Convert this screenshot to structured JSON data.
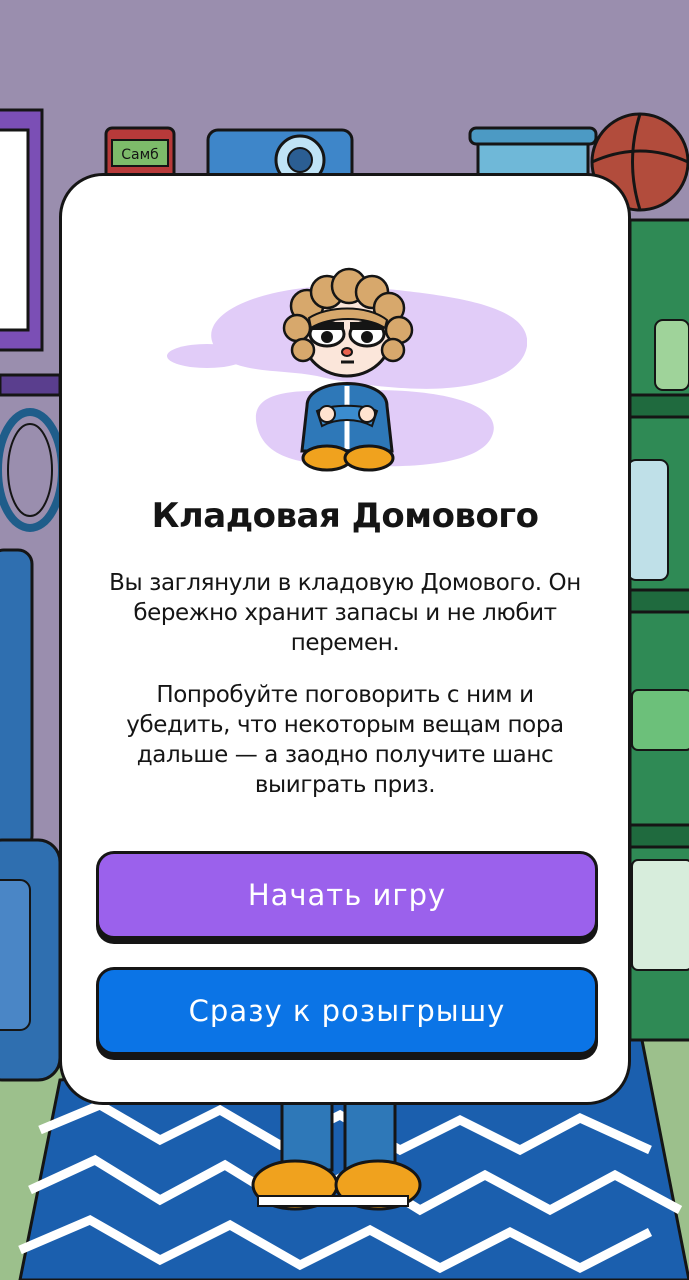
{
  "game": {
    "title": "Кладовая Домового",
    "description_1": "Вы заглянули в кладовую Домового. Он бережно хранит запасы и не любит перемен.",
    "description_2": "Попробуйте поговорить с ним и убедить, что некоторым вещам пора дальше — а заодно получите шанс выиграть приз.",
    "start_button": "Начать игру",
    "draw_button": "Сразу к розыгрышу",
    "background_can_label": "Самб"
  },
  "colors": {
    "start_button": "#9b61ec",
    "draw_button": "#0b74e6",
    "background": "#9a8eae",
    "blob": "#e1ccf8"
  },
  "icons": [
    "domovoy-character",
    "jar-can",
    "camera",
    "basketball",
    "container-box",
    "shelf",
    "suitcase",
    "bicycle-wheel",
    "rug"
  ]
}
